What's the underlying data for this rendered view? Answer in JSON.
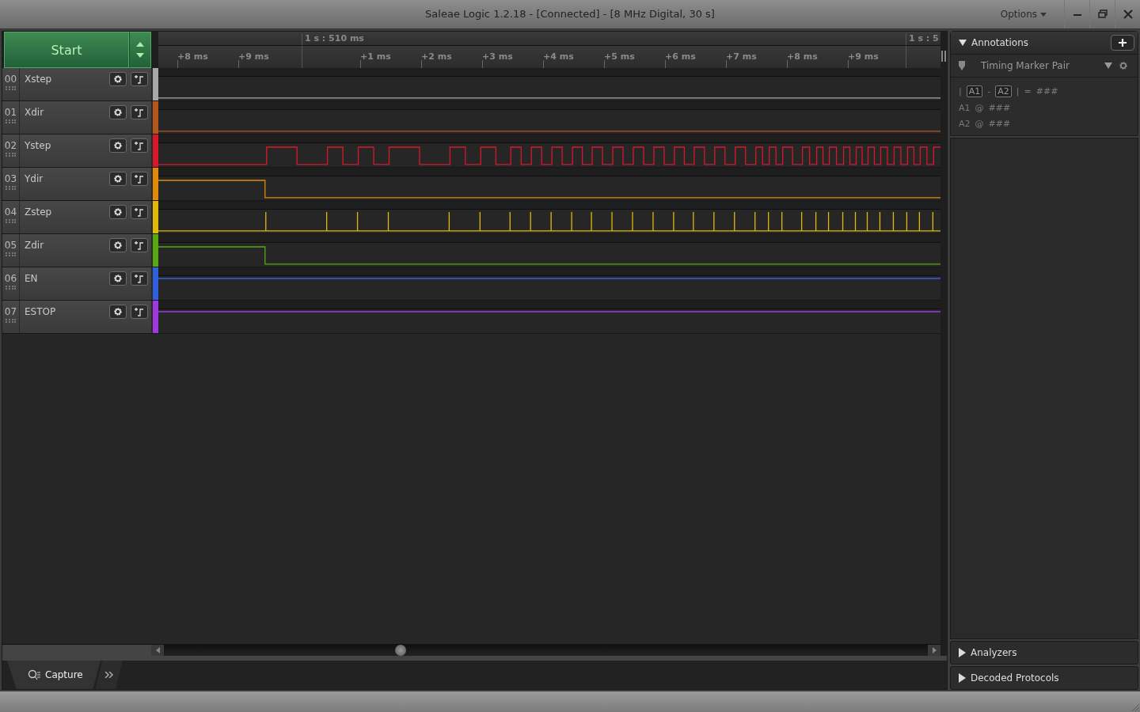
{
  "window": {
    "title": "Saleae Logic 1.2.18 - [Connected] - [8 MHz Digital, 30 s]",
    "options": "Options"
  },
  "start_button": {
    "label": "Start"
  },
  "timeline": {
    "markers": [
      "1 s : 510 ms",
      "1 s : 5"
    ],
    "ticks": [
      "+8 ms",
      "+9 ms",
      "+1 ms",
      "+2 ms",
      "+3 ms",
      "+4 ms",
      "+5 ms",
      "+6 ms",
      "+7 ms",
      "+8 ms",
      "+9 ms"
    ]
  },
  "channels": [
    {
      "number": "00",
      "name": "Xstep",
      "color": "#a8a8a8",
      "kind": "low"
    },
    {
      "number": "01",
      "name": "Xdir",
      "color": "#b4561a",
      "kind": "low"
    },
    {
      "number": "02",
      "name": "Ystep",
      "color": "#d8182a",
      "kind": "clock"
    },
    {
      "number": "03",
      "name": "Ydir",
      "color": "#e08a08",
      "kind": "fall"
    },
    {
      "number": "04",
      "name": "Zstep",
      "color": "#e0b808",
      "kind": "spikes"
    },
    {
      "number": "05",
      "name": "Zdir",
      "color": "#58a810",
      "kind": "fall"
    },
    {
      "number": "06",
      "name": "EN",
      "color": "#3060e0",
      "kind": "high"
    },
    {
      "number": "07",
      "name": "ESTOP",
      "color": "#a038e0",
      "kind": "high"
    }
  ],
  "annotations": {
    "title": "Annotations",
    "expanded": true,
    "marker_type": "Timing Marker Pair",
    "formula": [
      "|",
      "A1",
      "-",
      "A2",
      "|",
      "=",
      "###"
    ],
    "readouts": [
      {
        "marker": "A1",
        "at": "@",
        "value": "###"
      },
      {
        "marker": "A2",
        "at": "@",
        "value": "###"
      }
    ]
  },
  "panels": [
    {
      "title": "Analyzers",
      "expanded": false
    },
    {
      "title": "Decoded Protocols",
      "expanded": false
    }
  ],
  "bottom_tabs": [
    {
      "label": "Capture",
      "selected": true
    }
  ]
}
